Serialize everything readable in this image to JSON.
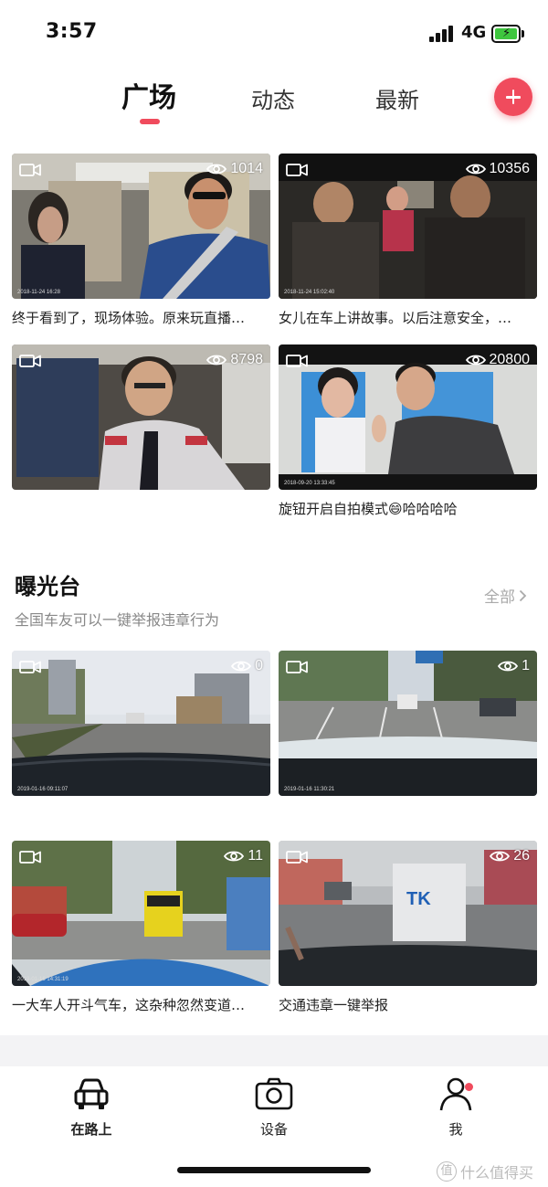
{
  "status_bar": {
    "time": "3:57",
    "network": "4G"
  },
  "tabs": [
    {
      "label": "广场",
      "active": true
    },
    {
      "label": "动态",
      "active": false
    },
    {
      "label": "最新",
      "active": false
    }
  ],
  "accent_color": "#f04b5d",
  "feed": [
    {
      "views": "1014",
      "caption": "终于看到了，现场体验。原来玩直播…",
      "stamp": "2018-11-24 16:28"
    },
    {
      "views": "10356",
      "caption": "女儿在车上讲故事。以后注意安全，…",
      "stamp": "2018-11-24 15:02:40"
    },
    {
      "views": "8798",
      "caption": "",
      "stamp": ""
    },
    {
      "views": "20800",
      "caption": "旋钮开启自拍模式😄哈哈哈哈",
      "stamp": "2018-09-20 13:33:45"
    }
  ],
  "exposure": {
    "title": "曝光台",
    "subtitle": "全国车友可以一键举报违章行为",
    "all_label": "全部",
    "items": [
      {
        "views": "0",
        "caption": "",
        "stamp": "2019-01-16 09:11:07"
      },
      {
        "views": "1",
        "caption": "",
        "stamp": "2019-01-16 11:30:21"
      },
      {
        "views": "11",
        "caption": "一大车人开斗气车，这杂种忽然变道…",
        "stamp": "2019-01-16 14:31:19"
      },
      {
        "views": "26",
        "caption": "交通违章一键举报",
        "stamp": ""
      }
    ]
  },
  "bottom_nav": [
    {
      "label": "在路上",
      "icon": "car-icon",
      "active": true
    },
    {
      "label": "设备",
      "icon": "camera-icon",
      "active": false
    },
    {
      "label": "我",
      "icon": "person-icon",
      "active": false,
      "badge": true
    }
  ],
  "watermark": {
    "logo": "值",
    "text": "什么值得买"
  }
}
